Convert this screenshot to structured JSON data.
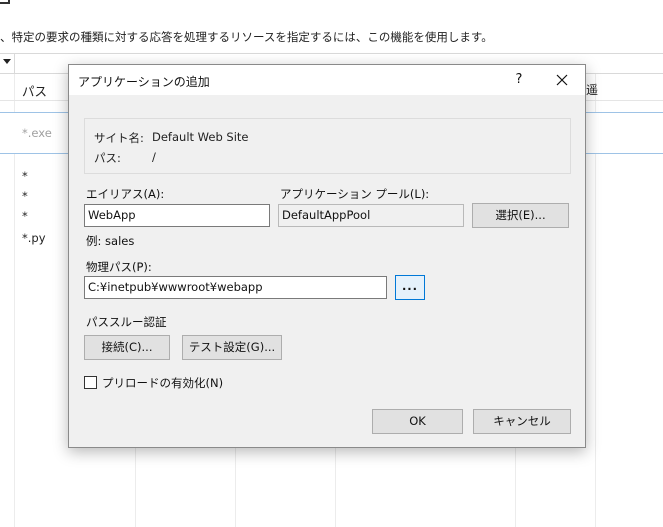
{
  "background": {
    "description": "、特定の要求の種類に対する応答を処理するリソースを指定するには、この機能を使用します。",
    "column_header_path": "パス",
    "column_header_right": "遥",
    "rows": [
      "*.exe",
      "*",
      "*",
      "*",
      "*.py"
    ]
  },
  "dialog": {
    "title": "アプリケーションの追加",
    "help_label": "?",
    "site_name_label": "サイト名:",
    "site_name_value": "Default Web Site",
    "path_label": "パス:",
    "path_value": "/",
    "alias_label": "エイリアス(A):",
    "alias_value": "WebApp",
    "alias_example": "例: sales",
    "app_pool_label": "アプリケーション プール(L):",
    "app_pool_value": "DefaultAppPool",
    "select_button": "選択(E)...",
    "physical_path_label": "物理パス(P):",
    "physical_path_value": "C:¥inetpub¥wwwroot¥webapp",
    "browse_button": "...",
    "passthrough_label": "パススルー認証",
    "connect_button": "接続(C)...",
    "test_settings_button": "テスト設定(G)...",
    "preload_label": "プリロードの有効化(N)",
    "preload_checked": false,
    "ok_button": "OK",
    "cancel_button": "キャンセル"
  },
  "colors": {
    "dialog_bg": "#f0f0f0",
    "accent_border": "#0078d7",
    "selection_border": "#9ec3e6"
  }
}
